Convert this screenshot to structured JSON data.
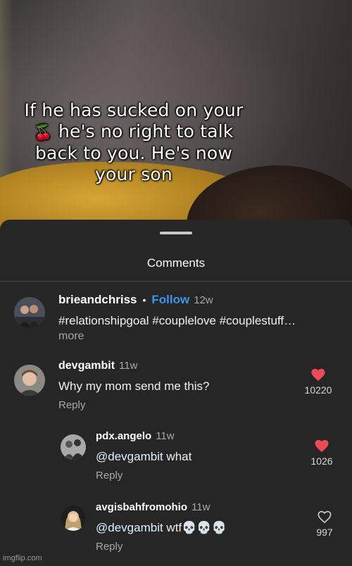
{
  "video": {
    "caption_lines": [
      "If he has sucked on your",
      "he's no right to talk",
      "back to you. He's now",
      "your son"
    ],
    "caption_emoji": "🍒"
  },
  "sheet": {
    "title": "Comments"
  },
  "post": {
    "username": "brieandchriss",
    "dot": "•",
    "follow_label": "Follow",
    "age": "12w",
    "text": "#relationshipgoal #couplelove #couplestuff…",
    "more_label": "more"
  },
  "comments": [
    {
      "username": "devgambit",
      "age": "11w",
      "text": "Why my mom send me this?",
      "reply_label": "Reply",
      "likes": "10220",
      "liked": true
    },
    {
      "username": "pdx.angelo",
      "age": "11w",
      "mention": "@devgambit",
      "text": " what",
      "reply_label": "Reply",
      "likes": "1026",
      "liked": true
    },
    {
      "username": "avgisbahfromohio",
      "age": "11w",
      "mention": "@devgambit",
      "text": " wtf💀💀💀",
      "reply_label": "Reply",
      "likes": "997",
      "liked": false
    }
  ],
  "colors": {
    "accent": "#3897f0",
    "like": "#ed4956",
    "background": "#262626"
  },
  "watermark": "imgflip.com"
}
